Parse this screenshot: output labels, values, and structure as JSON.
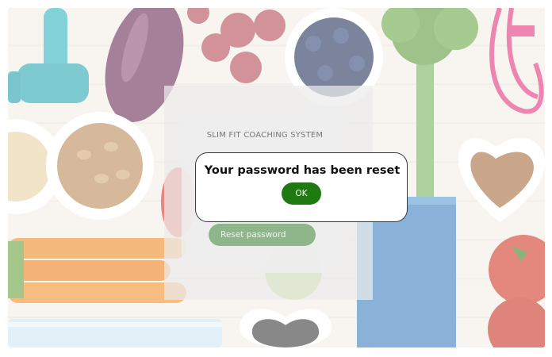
{
  "login_card": {
    "title": "SLIM FIT COACHING SYSTEM",
    "reset_button_label": "Reset password"
  },
  "dialog": {
    "message": "Your password has been reset",
    "ok_label": "OK"
  },
  "colors": {
    "primary_green": "#1f7a12",
    "muted_green": "#8fb58a",
    "card_background": "#eeeeee"
  }
}
